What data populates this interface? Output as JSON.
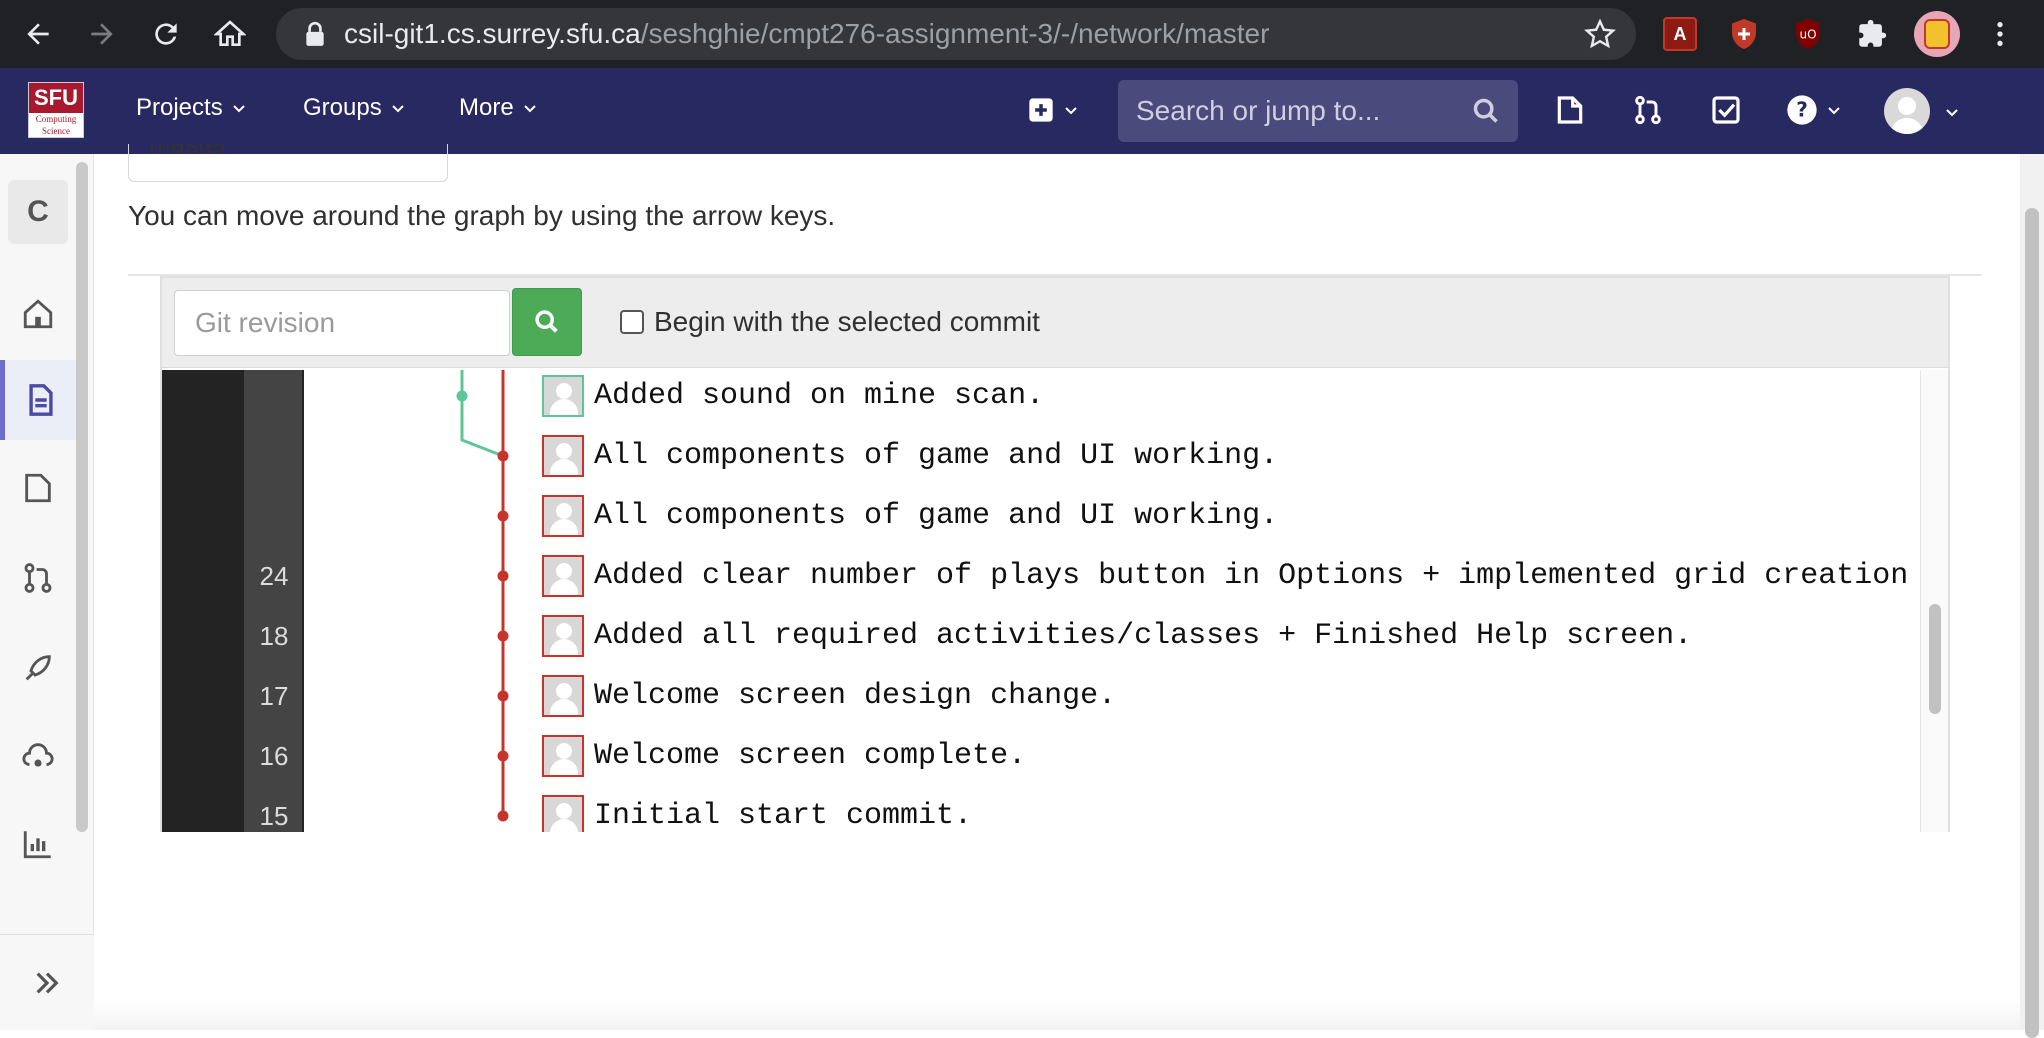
{
  "browser": {
    "url_host": "csil-git1.cs.surrey.sfu.ca",
    "url_path": "/seshghie/cmpt276-assignment-3/-/network/master"
  },
  "logo": {
    "top": "SFU",
    "bottom": "Computing Science"
  },
  "topnav": {
    "projects": "Projects",
    "groups": "Groups",
    "more": "More",
    "search_placeholder": "Search or jump to..."
  },
  "sidebar": {
    "project_letter": "C"
  },
  "main": {
    "branch_value": "master",
    "hint": "You can move around the graph by using the arrow keys.",
    "revision_placeholder": "Git revision",
    "begin_label": "Begin with the selected commit"
  },
  "commits": [
    {
      "num": "",
      "message": "Added sound on mine scan.",
      "branch": "side"
    },
    {
      "num": "",
      "message": "All components of game and UI working.",
      "branch": "main"
    },
    {
      "num": "",
      "message": "All components of game and UI working.",
      "branch": "main"
    },
    {
      "num": "24",
      "message": "Added clear number of plays button in Options + implemented grid creation for g",
      "branch": "main"
    },
    {
      "num": "18",
      "message": "Added all required activities/classes + Finished Help screen.",
      "branch": "main"
    },
    {
      "num": "17",
      "message": "Welcome screen design change.",
      "branch": "main"
    },
    {
      "num": "16",
      "message": "Welcome screen complete.",
      "branch": "main"
    },
    {
      "num": "15",
      "message": "Initial start commit.",
      "branch": "main"
    }
  ],
  "colors": {
    "main_branch": "#c6342c",
    "side_branch": "#5ec59a",
    "nav": "#292961"
  }
}
